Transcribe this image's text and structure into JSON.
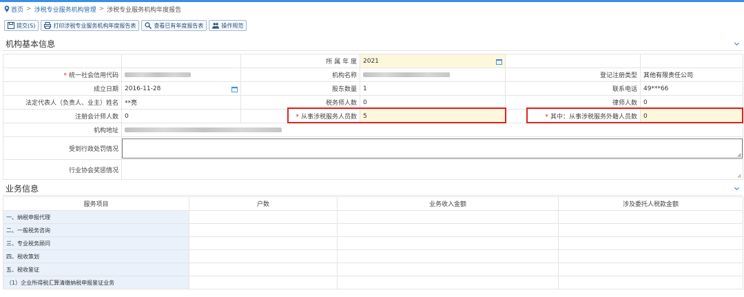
{
  "breadcrumb": {
    "home": "首页",
    "level1": "涉税专业服务机构管理",
    "level2": "涉税专业服务机构年度报告",
    "separator": ">"
  },
  "toolbar": {
    "submit": "提交(S)",
    "print": "打印涉税专业服务机构年度报告表",
    "view": "查看已有年度报告表",
    "guide": "操作规范"
  },
  "basic": {
    "title": "机构基本信息",
    "year_label": "所 属 年 度",
    "year_value": "2021",
    "credit_code_label": "统一社会信用代码",
    "org_name_label": "机构名称",
    "reg_type_label": "登记注册类型",
    "reg_type_value": "其他有限责任公司",
    "established_label": "成立日期",
    "established_value": "2016-11-28",
    "shareholders_label": "股东数量",
    "shareholders_value": "1",
    "phone_label": "联系电话",
    "phone_value": "49***66",
    "legal_rep_label": "法定代表人（负责人、业主）姓名",
    "legal_rep_value": "**亮",
    "tax_agents_label": "税务师人数",
    "tax_agents_value": "0",
    "lawyers_label": "律师人数",
    "lawyers_value": "0",
    "cpas_label": "注册会计师人数",
    "cpas_value": "0",
    "staff_label": "从事涉税服务人员数",
    "staff_value": "5",
    "foreign_staff_label": "其中：从事涉税服务外籍人员数",
    "foreign_staff_value": "0",
    "address_label": "机构地址",
    "penalty_label": "受到行政处罚情况",
    "award_label": "行业协会奖惩情况"
  },
  "business": {
    "title": "业务信息",
    "columns": [
      "服务项目",
      "户数",
      "业务收入金额",
      "涉及委托人税款金额"
    ],
    "rows": [
      "一、纳税申报代理",
      "二、一般税务咨询",
      "三、专业税务顾问",
      "四、税收策划",
      "五、税收鉴证",
      "（1）企业所得税汇算清缴纳税申报鉴证业务"
    ]
  },
  "colors": {
    "accent": "#3a8ee6",
    "link": "#2b6cb0",
    "required": "#e2231a",
    "highlight_box": "#e02020",
    "field_yellow": "#fdf8dc",
    "row_blue": "#e9f1fb"
  }
}
